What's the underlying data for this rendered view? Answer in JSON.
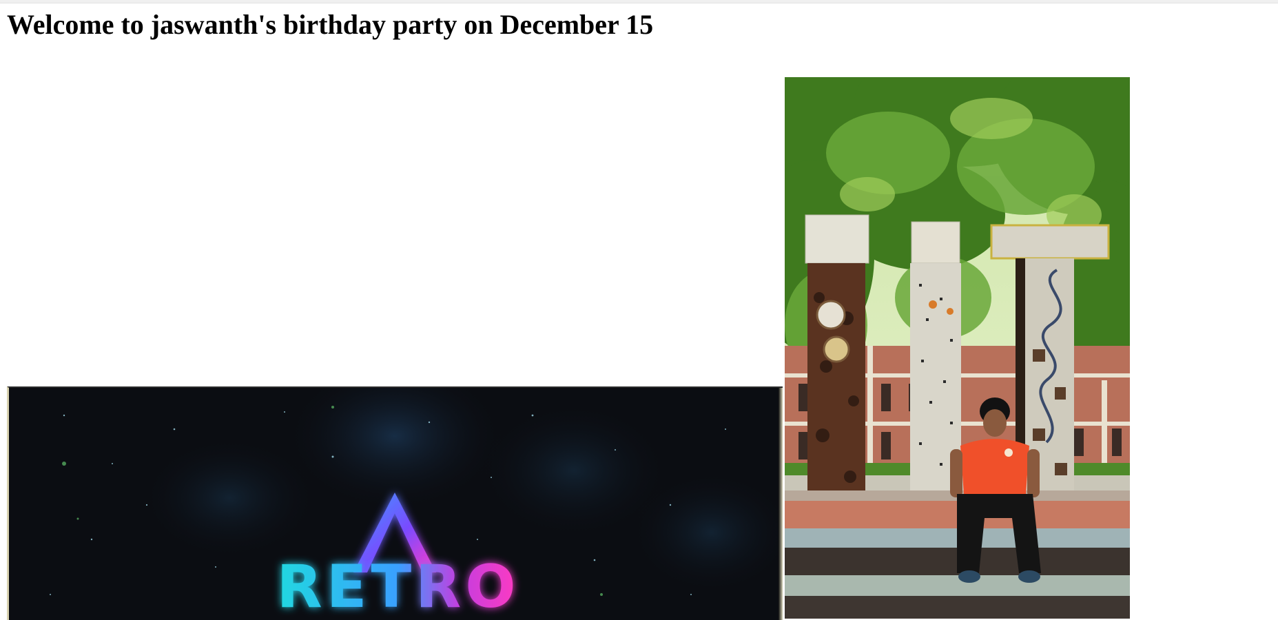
{
  "page": {
    "title": "Welcome to jaswanth's birthday party on December 15"
  },
  "poster": {
    "logo_text": "RETRO",
    "colors": {
      "background": "#0b0d12",
      "neon_cyan": "#28e0e6",
      "neon_magenta": "#e53bd2",
      "neon_blue": "#3a7bff"
    }
  },
  "photo": {
    "colors": {
      "foliage": "#3f7a1e",
      "building": "#b8705a",
      "shirt": "#f0502a",
      "steps": "#8a8070"
    }
  }
}
